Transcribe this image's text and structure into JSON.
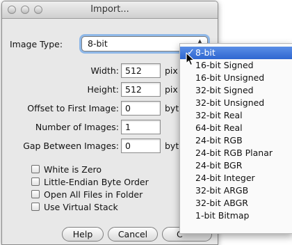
{
  "window": {
    "title": "Import..."
  },
  "image_type": {
    "label": "Image Type:",
    "value": "8-bit"
  },
  "fields": [
    {
      "label": "Width:",
      "value": "512",
      "unit": "pix"
    },
    {
      "label": "Height:",
      "value": "512",
      "unit": "pix"
    },
    {
      "label": "Offset to First Image:",
      "value": "0",
      "unit": "byt"
    },
    {
      "label": "Number of Images:",
      "value": "1",
      "unit": ""
    },
    {
      "label": "Gap Between Images:",
      "value": "0",
      "unit": "byt"
    }
  ],
  "checkboxes": [
    {
      "label": "White is Zero",
      "checked": false
    },
    {
      "label": "Little-Endian Byte Order",
      "checked": false
    },
    {
      "label": "Open All Files in Folder",
      "checked": false
    },
    {
      "label": "Use Virtual Stack",
      "checked": false
    }
  ],
  "buttons": {
    "help": "Help",
    "cancel": "Cancel",
    "ok_partial": "C"
  },
  "menu": {
    "items": [
      {
        "label": "8-bit",
        "selected": true
      },
      {
        "label": "16-bit Signed"
      },
      {
        "label": "16-bit Unsigned"
      },
      {
        "label": "32-bit Signed"
      },
      {
        "label": "32-bit Unsigned"
      },
      {
        "label": "32-bit Real"
      },
      {
        "label": "64-bit Real"
      },
      {
        "label": "24-bit RGB"
      },
      {
        "label": "24-bit RGB Planar"
      },
      {
        "label": "24-bit BGR"
      },
      {
        "label": "24-bit Integer"
      },
      {
        "label": "32-bit ARGB"
      },
      {
        "label": "32-bit ABGR"
      },
      {
        "label": "1-bit Bitmap"
      }
    ]
  },
  "colors": {
    "selection": "#3a73d8",
    "focus_ring": "#8fb8e8",
    "window_bg": "#e8e8e8"
  }
}
